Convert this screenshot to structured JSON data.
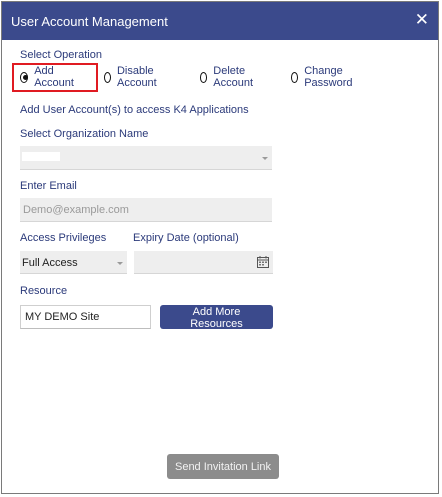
{
  "window": {
    "title": "User Account Management",
    "close_glyph": "✕"
  },
  "operation": {
    "label": "Select Operation",
    "options": [
      {
        "label": "Add Account",
        "checked": true
      },
      {
        "label": "Disable Account",
        "checked": false
      },
      {
        "label": "Delete Account",
        "checked": false
      },
      {
        "label": "Change Password",
        "checked": false
      }
    ]
  },
  "description": "Add User Account(s) to access K4 Applications",
  "organization": {
    "label": "Select Organization Name",
    "value": ""
  },
  "email": {
    "label": "Enter Email",
    "placeholder": "Demo@example.com",
    "value": ""
  },
  "access": {
    "label": "Access Privileges",
    "value": "Full Access"
  },
  "expiry": {
    "label": "Expiry Date (optional)",
    "value": ""
  },
  "resource": {
    "label": "Resource",
    "value": "MY DEMO Site",
    "add_button": "Add More Resources"
  },
  "footer": {
    "send_button": "Send Invitation Link"
  },
  "colors": {
    "header": "#3b4a8c",
    "label": "#2b3a7a",
    "highlight": "#e01b22",
    "disabled": "#8c8c8c"
  },
  "icons": {
    "calendar": "calendar-icon",
    "close": "close-icon",
    "dropdown": "chevron-down-icon"
  }
}
